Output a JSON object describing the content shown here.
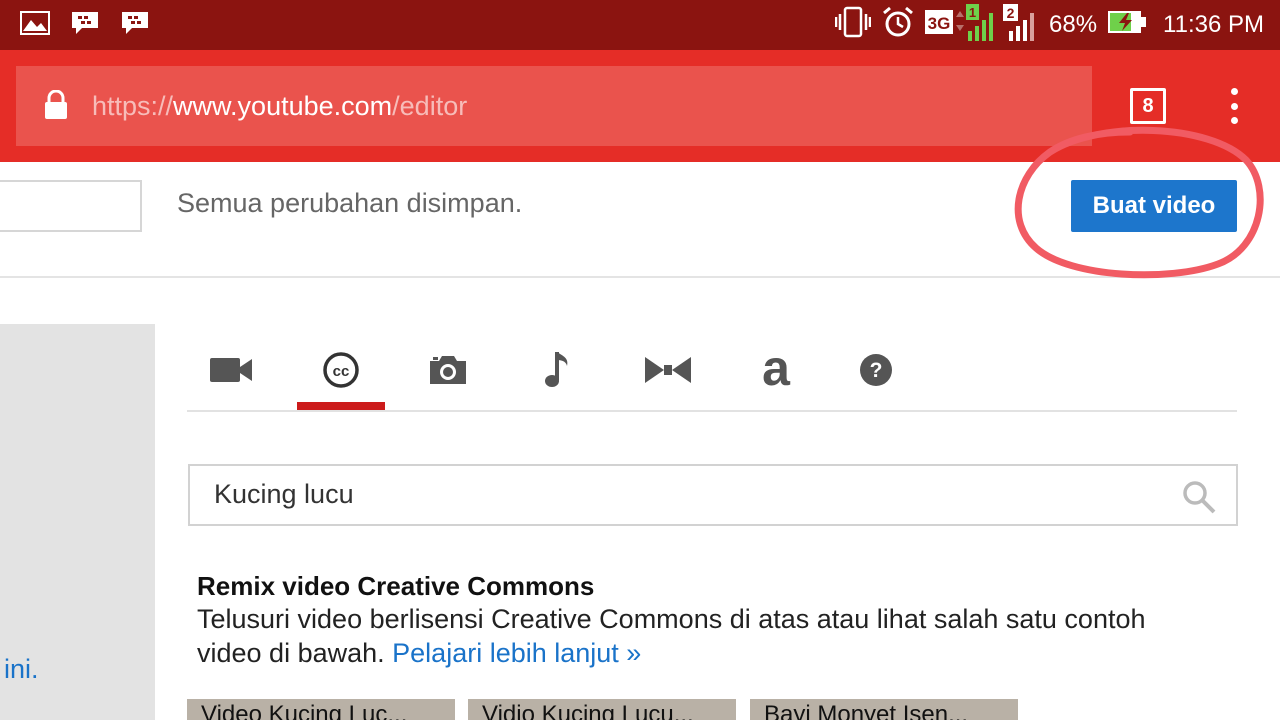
{
  "status_bar": {
    "time": "11:36 PM",
    "battery": "68%",
    "network": "3G",
    "sim1": "1",
    "sim2": "2",
    "icons": [
      "gallery-icon",
      "bbm-icon",
      "bbm-icon",
      "vibrate-icon",
      "alarm-icon",
      "signal-icon",
      "battery-charging-icon"
    ]
  },
  "browser": {
    "url_scheme": "https://",
    "url_host": "www.youtube.com",
    "url_path": "/editor",
    "tab_count": "8"
  },
  "editor": {
    "saved_status": "Semua perubahan disimpan.",
    "create_button": "Buat video",
    "left_link": "ini."
  },
  "tabs": [
    {
      "icon": "video-camera-icon",
      "active": false
    },
    {
      "icon": "creative-commons-icon",
      "active": true
    },
    {
      "icon": "photo-camera-icon",
      "active": false
    },
    {
      "icon": "music-note-icon",
      "active": false
    },
    {
      "icon": "transitions-icon",
      "active": false
    },
    {
      "icon": "text-icon",
      "active": false
    },
    {
      "icon": "help-icon",
      "active": false
    }
  ],
  "search": {
    "value": "Kucing lucu"
  },
  "info": {
    "title": "Remix video Creative Commons",
    "description": "Telusuri video berlisensi Creative Commons di atas atau lihat salah satu contoh video di bawah.",
    "link": "Pelajari lebih lanjut »"
  },
  "thumbnails": [
    {
      "title": "Video Kucing Luc..."
    },
    {
      "title": "Vidio Kucing Lucu..."
    },
    {
      "title": "Bayi Monyet Isen..."
    }
  ],
  "colors": {
    "status_bar": "#8b1410",
    "toolbar": "#e52d27",
    "button": "#1d76cc",
    "link": "#1a73c9",
    "active_tab": "#cc1b1b"
  }
}
